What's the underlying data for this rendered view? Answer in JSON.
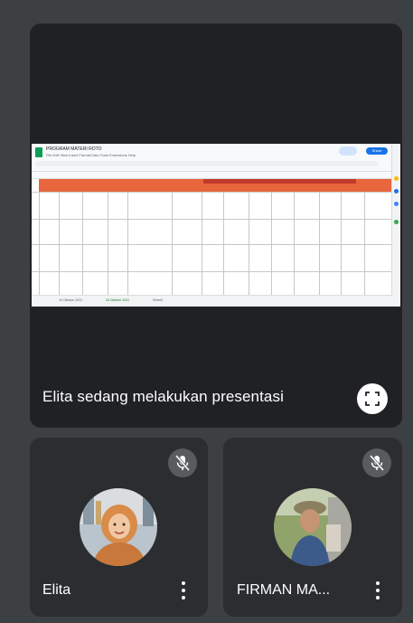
{
  "presentation": {
    "banner_text": "Elita sedang melakukan presentasi",
    "fullscreen_icon": "fullscreen-icon",
    "shared_sheet": {
      "title": "PROGRAM MATERI ROTO",
      "menu": "File  Edit  View  Insert  Format  Data  Tools  Extensions  Help",
      "share_label": "Share",
      "header_accent": "#e8663c",
      "tabs": [
        "19 Oktober 2022",
        "26 Oktober 2022",
        "Sheet4"
      ]
    }
  },
  "participants": [
    {
      "name": "Elita",
      "mic_status_icon": "mic-off-icon",
      "more_icon": "more-vert-icon"
    },
    {
      "name": "FIRMAN MA...",
      "mic_status_icon": "mic-off-icon",
      "more_icon": "more-vert-icon"
    }
  ],
  "colors": {
    "background": "#3c4043",
    "stage": "#202124",
    "tile": "#2b2d30",
    "sheet_green": "#0f9d58"
  }
}
